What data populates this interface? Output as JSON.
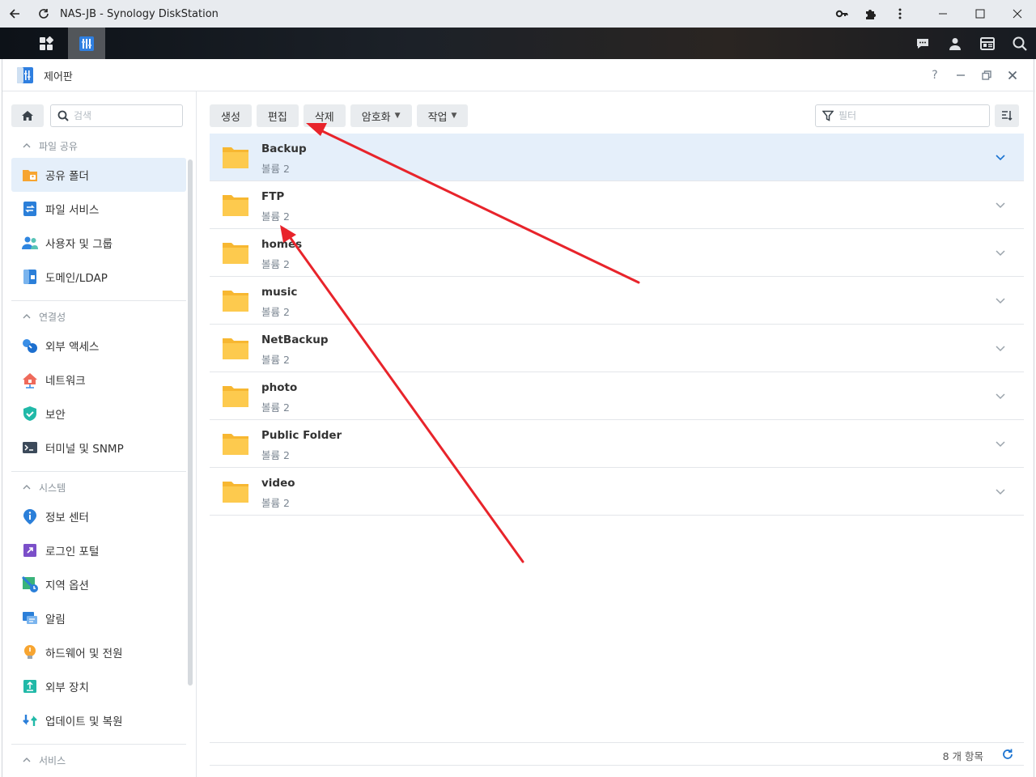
{
  "browser": {
    "title": "NAS-JB - Synology DiskStation"
  },
  "window": {
    "title": "제어판"
  },
  "sidebar": {
    "search_placeholder": "검색",
    "sections": [
      {
        "label": "파일 공유",
        "items": [
          {
            "label": "공유 폴더",
            "active": true
          },
          {
            "label": "파일 서비스"
          },
          {
            "label": "사용자 및 그룹"
          },
          {
            "label": "도메인/LDAP"
          }
        ]
      },
      {
        "label": "연결성",
        "items": [
          {
            "label": "외부 액세스"
          },
          {
            "label": "네트워크"
          },
          {
            "label": "보안"
          },
          {
            "label": "터미널 및 SNMP"
          }
        ]
      },
      {
        "label": "시스템",
        "items": [
          {
            "label": "정보 센터"
          },
          {
            "label": "로그인 포털"
          },
          {
            "label": "지역 옵션"
          },
          {
            "label": "알림"
          },
          {
            "label": "하드웨어 및 전원"
          },
          {
            "label": "외부 장치"
          },
          {
            "label": "업데이트 및 복원"
          }
        ]
      },
      {
        "label": "서비스",
        "items": []
      }
    ]
  },
  "toolbar": {
    "create": "생성",
    "edit": "편집",
    "delete": "삭제",
    "encryption": "암호화",
    "action": "작업",
    "filter_placeholder": "필터"
  },
  "folders": [
    {
      "name": "Backup",
      "volume": "볼륨 2",
      "selected": true
    },
    {
      "name": "FTP",
      "volume": "볼륨 2"
    },
    {
      "name": "homes",
      "volume": "볼륨 2"
    },
    {
      "name": "music",
      "volume": "볼륨 2"
    },
    {
      "name": "NetBackup",
      "volume": "볼륨 2"
    },
    {
      "name": "photo",
      "volume": "볼륨 2"
    },
    {
      "name": "Public Folder",
      "volume": "볼륨 2"
    },
    {
      "name": "video",
      "volume": "볼륨 2"
    }
  ],
  "footer": {
    "count": "8 개 항목"
  },
  "colors": {
    "accent": "#1a73d1",
    "folder": "#fcc43f",
    "selection": "#e5effa",
    "annotation_arrow": "#e8242b"
  }
}
